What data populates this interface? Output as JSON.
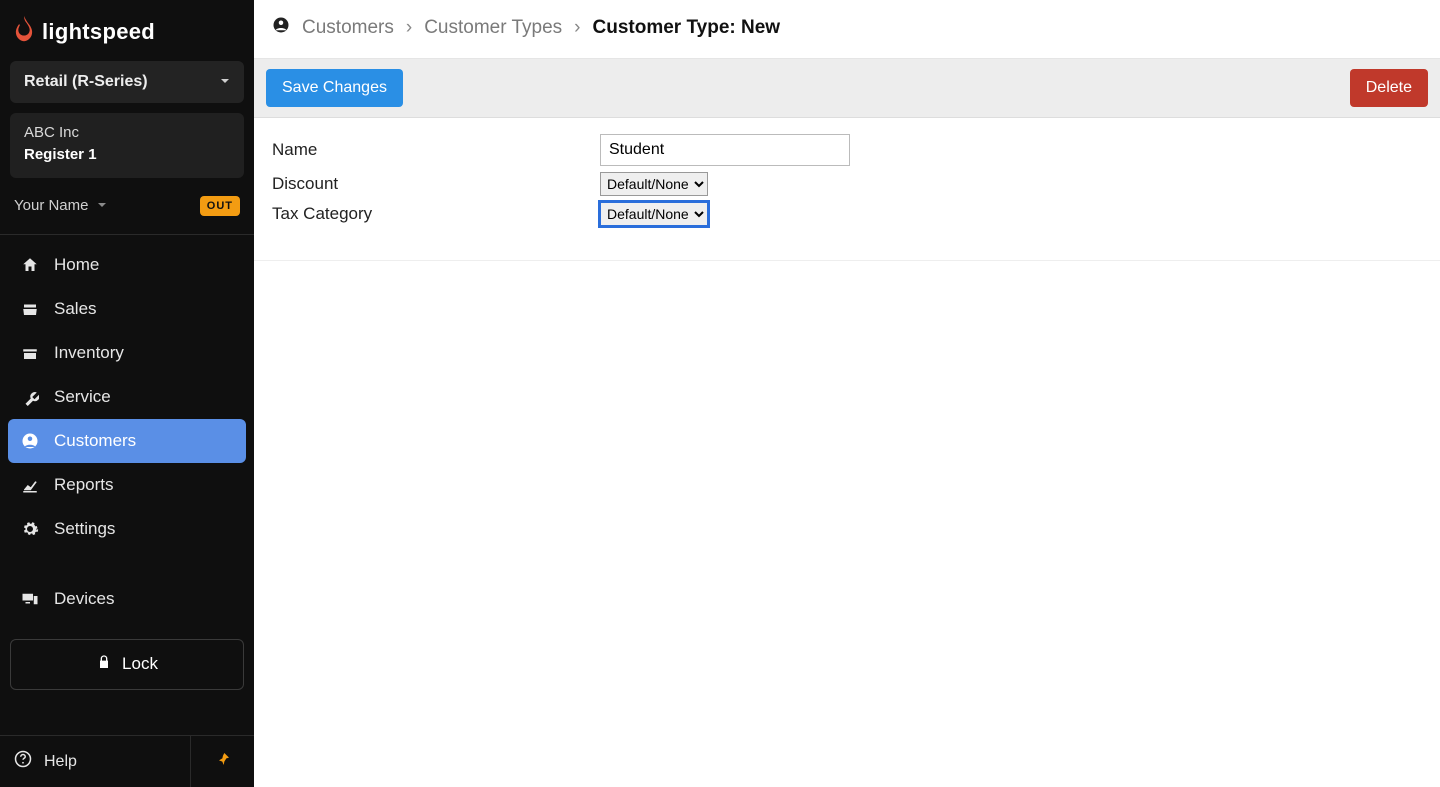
{
  "brand": {
    "name": "lightspeed"
  },
  "product": {
    "label": "Retail (R-Series)"
  },
  "company": {
    "name": "ABC Inc",
    "register": "Register 1"
  },
  "user": {
    "name": "Your Name",
    "badge": "OUT"
  },
  "nav": {
    "home": "Home",
    "sales": "Sales",
    "inventory": "Inventory",
    "service": "Service",
    "customers": "Customers",
    "reports": "Reports",
    "settings": "Settings",
    "devices": "Devices"
  },
  "lock": {
    "label": "Lock"
  },
  "help": {
    "label": "Help"
  },
  "breadcrumbs": {
    "level1": "Customers",
    "level2": "Customer Types",
    "current": "Customer Type: New"
  },
  "actions": {
    "save": "Save Changes",
    "delete": "Delete"
  },
  "form": {
    "name_label": "Name",
    "name_value": "Student",
    "discount_label": "Discount",
    "discount_value": "Default/None",
    "tax_label": "Tax Category",
    "tax_value": "Default/None"
  }
}
